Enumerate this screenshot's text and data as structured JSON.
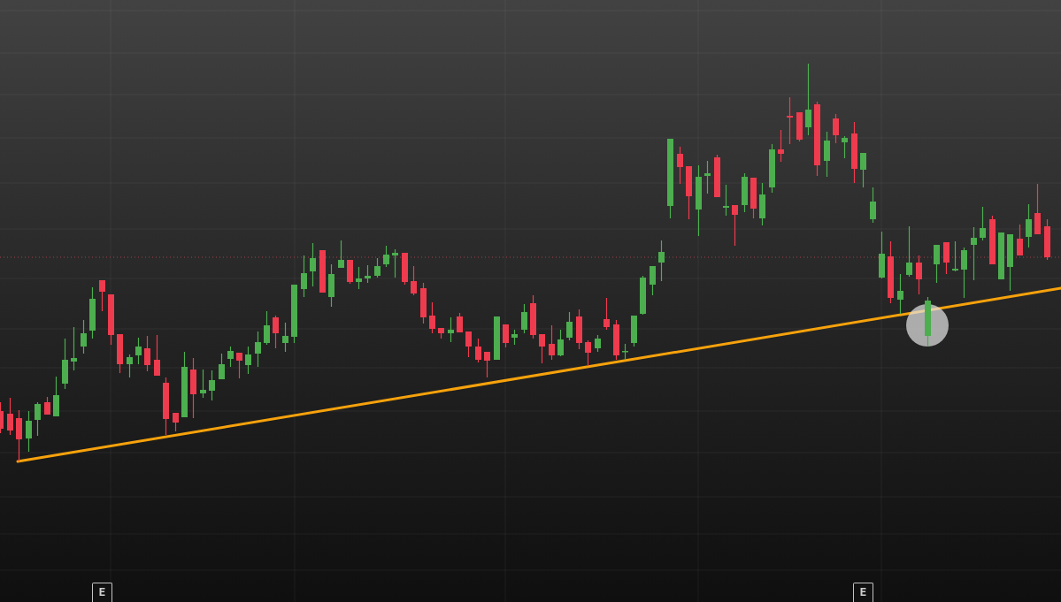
{
  "chart": {
    "event_markers": [
      {
        "label": "E"
      },
      {
        "label": "E"
      }
    ]
  }
}
